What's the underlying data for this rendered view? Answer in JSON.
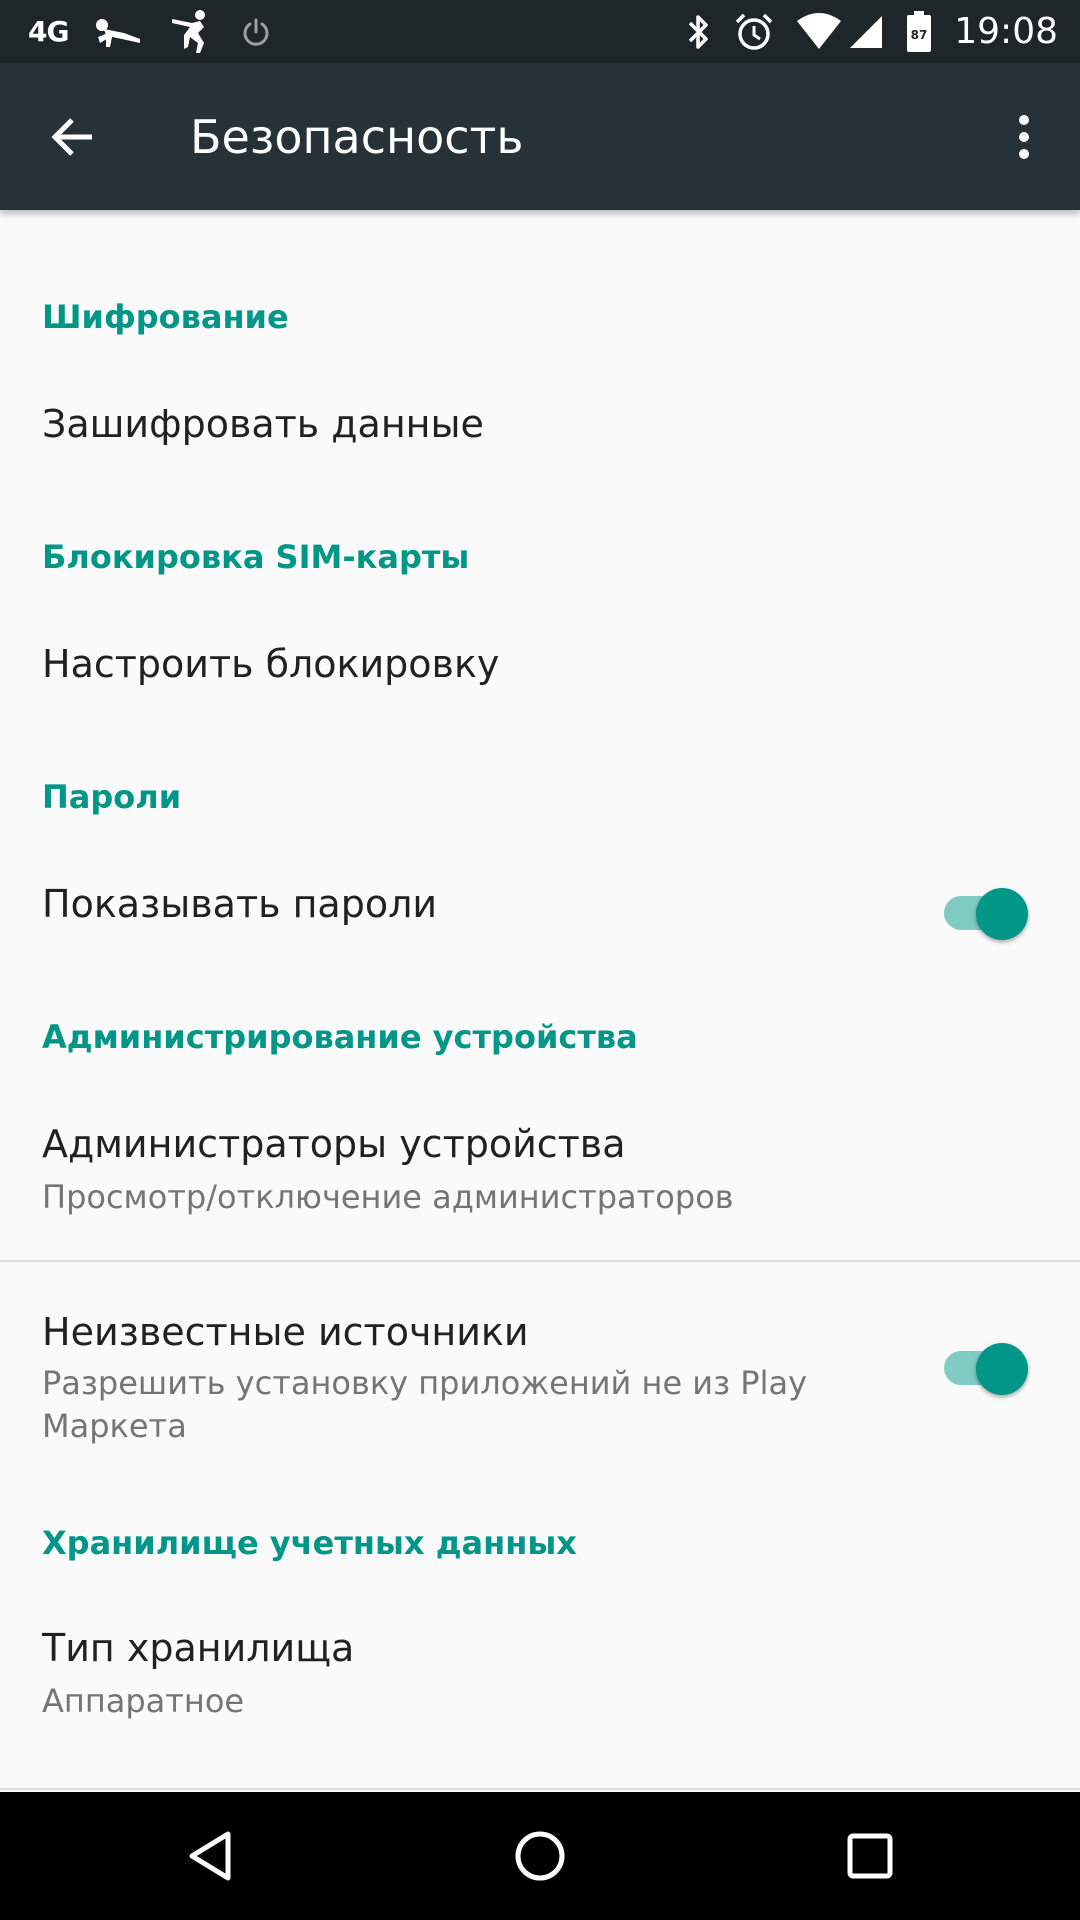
{
  "status_bar": {
    "network_type": "4G",
    "battery_level": "87",
    "time": "19:08",
    "icons_left": [
      "pushup-icon",
      "exercise-figure-icon",
      "power-icon"
    ],
    "icons_right": [
      "bluetooth-icon",
      "alarm-icon",
      "wifi-icon",
      "signal-icon",
      "battery-icon"
    ]
  },
  "app_bar": {
    "title": "Безопасность",
    "back_icon": "arrow-back-icon",
    "menu_icon": "more-vert-icon"
  },
  "sections": [
    {
      "header": "Шифрование",
      "items": [
        {
          "title": "Зашифровать данные"
        }
      ]
    },
    {
      "header": "Блокировка SIM-карты",
      "items": [
        {
          "title": "Настроить блокировку"
        }
      ]
    },
    {
      "header": "Пароли",
      "items": [
        {
          "title": "Показывать пароли",
          "toggle": true
        }
      ]
    },
    {
      "header": "Администрирование устройства",
      "items": [
        {
          "title": "Администраторы устройства",
          "summary": "Просмотр/отключение администраторов"
        },
        {
          "title": "Неизвестные источники",
          "summary": "Разрешить установку приложений не из Play Маркета",
          "toggle": true
        }
      ]
    },
    {
      "header": "Хранилище учетных данных",
      "items": [
        {
          "title": "Тип хранилища",
          "summary": "Аппаратное"
        }
      ]
    }
  ],
  "colors": {
    "accent": "#009688",
    "app_bar": "#263238",
    "status_bar": "#1f262a",
    "background": "#fafafa"
  },
  "nav_bar": {
    "icons": [
      "back-triangle-icon",
      "home-circle-icon",
      "recents-square-icon"
    ]
  }
}
